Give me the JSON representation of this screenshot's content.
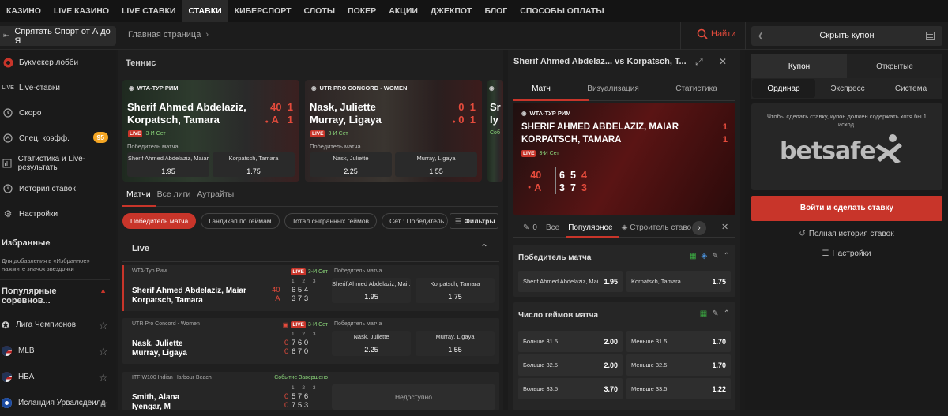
{
  "nav": [
    "КАЗИНО",
    "LIVE КАЗИНО",
    "LIVE СТАВКИ",
    "СТАВКИ",
    "КИБЕРСПОРТ",
    "СЛОТЫ",
    "ПОКЕР",
    "АКЦИИ",
    "ДЖЕКПОТ",
    "БЛОГ",
    "СПОСОБЫ ОПЛАТЫ"
  ],
  "subbar": {
    "hide_label": "Спрятать Спорт от А до Я",
    "crumb": "Главная страница",
    "search": "Найти",
    "coupon": "Скрыть купон"
  },
  "sidebar": {
    "items": [
      {
        "label": "Букмекер лобби"
      },
      {
        "label": "Live-ставки"
      },
      {
        "label": "Скоро"
      },
      {
        "label": "Спец. коэфф.",
        "badge": "95"
      },
      {
        "label": "Статистика и Live-результаты"
      },
      {
        "label": "История ставок"
      },
      {
        "label": "Настройки"
      }
    ],
    "fav_title": "Избранные",
    "fav_note": "Для добавления в «Избранное» нажмите значок звездочки",
    "popular_title": "Популярные соревнов...",
    "comps": [
      {
        "label": "Лига Чемпионов"
      },
      {
        "label": "MLB"
      },
      {
        "label": "НБА"
      },
      {
        "label": "Исландия Урвалсдеилд"
      }
    ]
  },
  "center": {
    "title": "Теннис",
    "cards": [
      {
        "league": "WTA-ТУР РИМ",
        "p1": "Sherif Ahmed Abdelaziz,",
        "p2": "Korpatsch, Tamara",
        "s1a": "40",
        "s1b": "1",
        "s2a": "A",
        "s2b": "1",
        "set": "3-И Сет",
        "live": "LIVE",
        "market": "Победитель матча",
        "o1": "Sherif Ahmed Abdelaziz, Maiar",
        "v1": "1.95",
        "o2": "Korpatsch, Tamara",
        "v2": "1.75"
      },
      {
        "league": "UTR PRO CONCORD - WOMEN",
        "p1": "Nask, Juliette",
        "p2": "Murray, Ligaya",
        "s1a": "0",
        "s1b": "1",
        "s2a": "0",
        "s2b": "1",
        "set": "3-И Сет",
        "live": "LIVE",
        "market": "Победитель матча",
        "o1": "Nask, Juliette",
        "v1": "2.25",
        "o2": "Murray, Ligaya",
        "v2": "1.55"
      }
    ],
    "card3_p1": "Sr",
    "card3_p2": "Iy",
    "card3_set": "Соб",
    "tabs": [
      "Матчи",
      "Все лиги",
      "Аутрайты"
    ],
    "filters": [
      "Победитель матча",
      "Гандикап по геймам",
      "Тотал сыгранных геймов",
      "Сет : Победитель"
    ],
    "filter_btn": "Фильтры",
    "live_title": "Live",
    "matches": [
      {
        "league": "WTA-Тур Рим",
        "status": "3-И Сет",
        "live": "LIVE",
        "market": "Победитель матча",
        "p1": "Sherif Ahmed Abdelaziz, Maiar",
        "p2": "Korpatsch, Tamara",
        "score1": "40",
        "score2": "A",
        "games1": "6 5 4",
        "games2": "3 7 3",
        "o1": "Sherif Ahmed Abdelaziz, Mai...",
        "v1": "1.95",
        "o2": "Korpatsch, Tamara",
        "v2": "1.75"
      },
      {
        "league": "UTR Pro Concord - Women",
        "status": "3-И Сет",
        "live": "LIVE",
        "market": "Победитель матча",
        "p1": "Nask, Juliette",
        "p2": "Murray, Ligaya",
        "score1": "0",
        "score2": "0",
        "games1": "7 6 0",
        "games2": "6 7 0",
        "o1": "Nask, Juliette",
        "v1": "2.25",
        "o2": "Murray, Ligaya",
        "v2": "1.55"
      },
      {
        "league": "ITF W100 Indian Harbour Beach",
        "status": "Событие Завершено",
        "p1": "Smith, Alana",
        "p2": "Iyengar, M",
        "score1": "0",
        "score2": "0",
        "games1": "5 7 6",
        "games2": "7 5 3",
        "unavailable": "Недоступно"
      }
    ],
    "set_header": "1 2 3"
  },
  "detail": {
    "title": "Sherif Ahmed Abdelaz... vs Korpatsch, T...",
    "tabs": [
      "Матч",
      "Визуализация",
      "Статистика"
    ],
    "league": "WTA-ТУР РИМ",
    "p1": "SHERIF AHMED ABDELAZIZ, MAIAR",
    "p2": "KORPATSCH, TAMARA",
    "s1": "1",
    "s2": "1",
    "set": "3-И Сет",
    "live": "LIVE",
    "pts1": "40",
    "pts2": "A",
    "g1": "6",
    "g2": "3",
    "h1": "5",
    "h2": "7",
    "k1": "4",
    "k2": "3",
    "mtabs": [
      "0",
      "Все",
      "Популярное",
      "Строитель ставо"
    ],
    "sections": [
      {
        "title": "Победитель матча",
        "odds": [
          {
            "l": "Sherif Ahmed Abdelaziz, Mai...",
            "v": "1.95"
          },
          {
            "l": "Korpatsch, Tamara",
            "v": "1.75"
          }
        ]
      },
      {
        "title": "Число геймов матча",
        "odds": [
          {
            "l": "Больше 31.5",
            "v": "2.00"
          },
          {
            "l": "Меньше 31.5",
            "v": "1.70"
          },
          {
            "l": "Больше 32.5",
            "v": "2.00"
          },
          {
            "l": "Меньше 32.5",
            "v": "1.70"
          },
          {
            "l": "Больше 33.5",
            "v": "3.70"
          },
          {
            "l": "Меньше 33.5",
            "v": "1.22"
          }
        ]
      }
    ]
  },
  "coupon": {
    "tabs": [
      "Купон",
      "Открытые"
    ],
    "types": [
      "Ординар",
      "Экспресс",
      "Система"
    ],
    "msg": "Чтобы сделать ставку, купон должен содержать хотя бы 1 исход.",
    "logo": "betsafe",
    "login": "Войти и сделать ставку",
    "history": "Полная история ставок",
    "settings": "Настройки"
  },
  "colors": {
    "accent": "#c8352a",
    "green": "#8bd67a",
    "badge": "#f5a623"
  }
}
